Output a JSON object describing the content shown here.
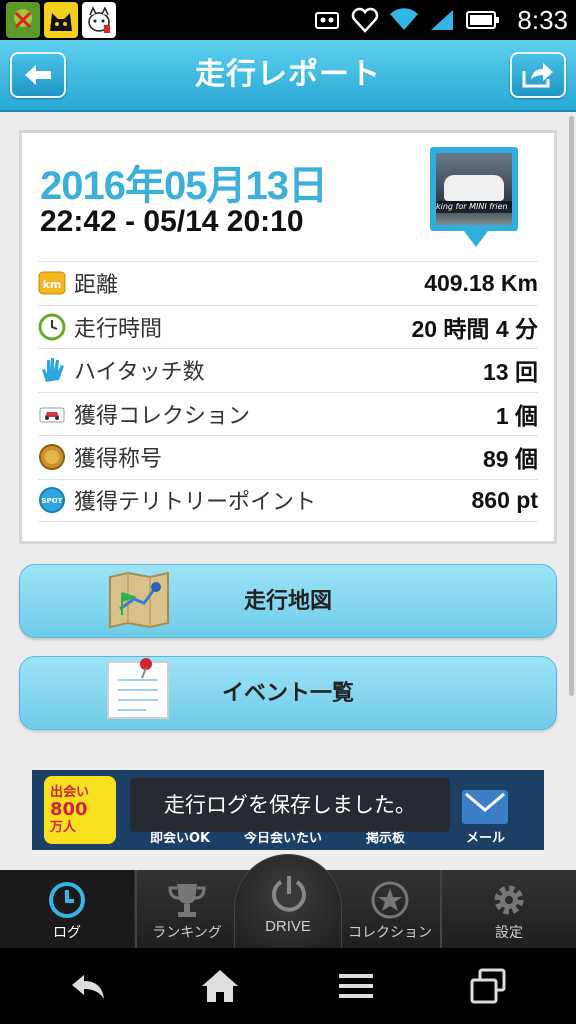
{
  "status_bar": {
    "time": "8:33"
  },
  "header": {
    "title": "走行レポート"
  },
  "report": {
    "date": "2016年05月13日",
    "range": "22:42 - 05/14 20:10",
    "thumbnail_caption": "king for MINI frien",
    "stats": [
      {
        "icon": "km-icon",
        "label": "距離",
        "value": "409.18 Km"
      },
      {
        "icon": "clock-icon",
        "label": "走行時間",
        "value": "20 時間 4 分"
      },
      {
        "icon": "high-five-icon",
        "label": "ハイタッチ数",
        "value": "13 回"
      },
      {
        "icon": "car-icon",
        "label": "獲得コレクション",
        "value": "1 個"
      },
      {
        "icon": "medal-icon",
        "label": "獲得称号",
        "value": "89 個"
      },
      {
        "icon": "spot-icon",
        "label": "獲得テリトリーポイント",
        "value": "860 pt"
      }
    ],
    "km_badge": "km",
    "spot_badge": "SPOT"
  },
  "actions": {
    "map_label": "走行地図",
    "event_label": "イベント一覧"
  },
  "ad": {
    "logo_line1": "出会い",
    "logo_line2": "800",
    "logo_line3": "万人",
    "label1": "即会いOK",
    "label2": "今日会いたい",
    "label3": "掲示板",
    "label4": "メール"
  },
  "toast": "走行ログを保存しました。",
  "tabs": {
    "log": "ログ",
    "ranking": "ランキング",
    "drive": "DRIVE",
    "collection": "コレクション",
    "settings": "設定"
  }
}
